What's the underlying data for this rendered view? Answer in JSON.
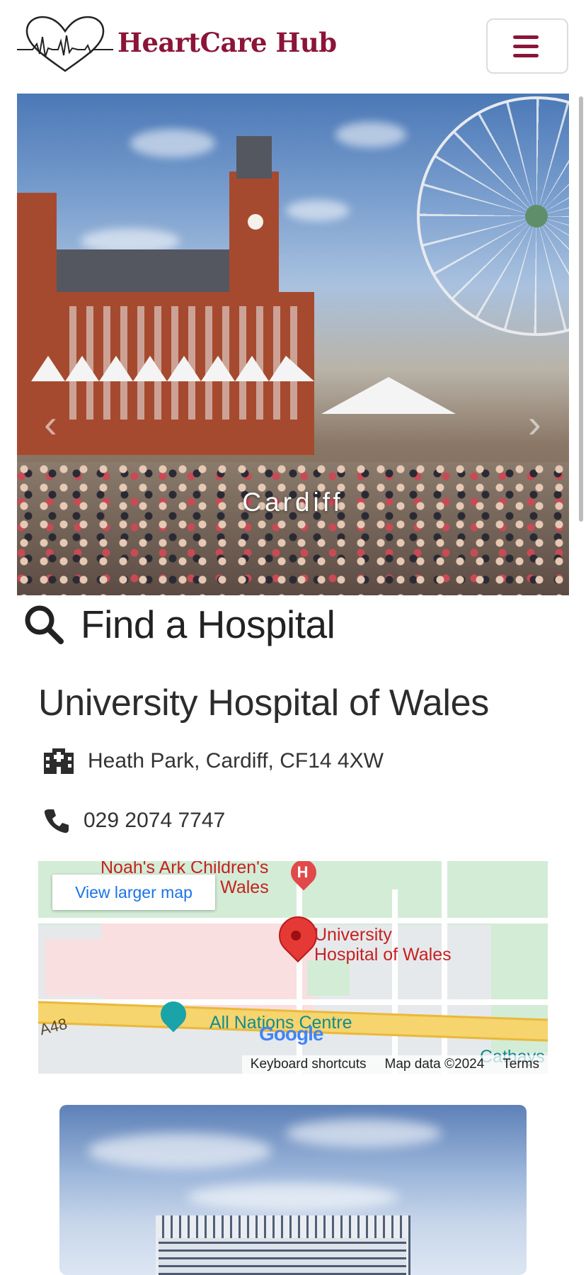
{
  "header": {
    "brand": "HeartCare Hub",
    "logo_icon": "heart-ecg-icon",
    "menu_icon": "hamburger-menu-icon",
    "brand_color": "#8a1538"
  },
  "hero": {
    "caption": "Cardiff",
    "prev_icon": "chevron-left-icon",
    "next_icon": "chevron-right-icon"
  },
  "find": {
    "icon": "search-icon",
    "title": "Find a Hospital"
  },
  "hospital": {
    "name": "University Hospital of Wales",
    "address_icon": "hospital-building-icon",
    "address": "Heath Park, Cardiff, CF14 4XW",
    "phone_icon": "phone-icon",
    "phone": "029 2074 7747"
  },
  "map": {
    "view_larger": "View larger map",
    "labels": {
      "noahs_ark_line1": "Noah's Ark Children's",
      "noahs_ark_line2": "or Wales",
      "uhw_line1": "University",
      "uhw_line2": "Hospital of Wales",
      "all_nations": "All Nations Centre",
      "a48": "A48",
      "cathays": "Cathays"
    },
    "google": "Google",
    "footer": {
      "shortcuts": "Keyboard shortcuts",
      "map_data": "Map data ©2024",
      "terms": "Terms"
    },
    "pin_icon": "map-pin-icon",
    "hospital_marker_icon": "hospital-h-marker-icon",
    "place_marker_icon": "place-marker-icon"
  }
}
